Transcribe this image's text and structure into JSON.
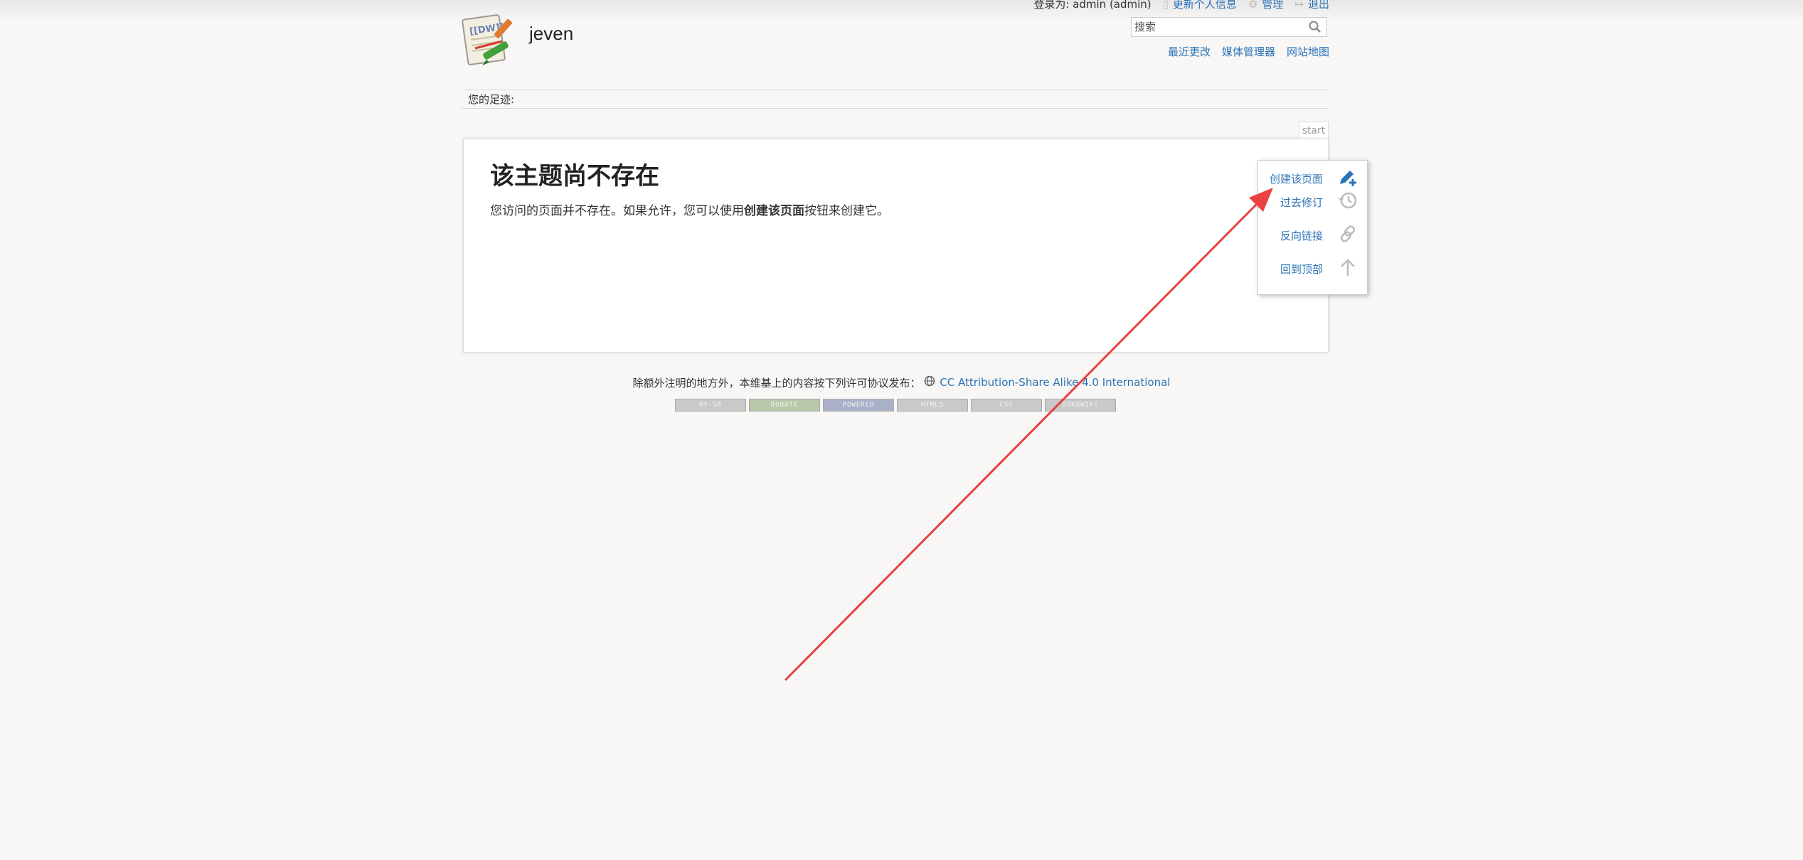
{
  "site": {
    "title": "jeven"
  },
  "user_tools": {
    "logged_in_as": "登录为: admin (admin)",
    "update_profile": "更新个人信息",
    "admin": "管理",
    "logout": "退出"
  },
  "search": {
    "placeholder": "搜索"
  },
  "site_tools": {
    "recent_changes": "最近更改",
    "media_manager": "媒体管理器",
    "sitemap": "网站地图"
  },
  "breadcrumbs": {
    "label": "您的足迹:"
  },
  "page_id": "start",
  "content": {
    "heading": "该主题尚不存在",
    "body_prefix": "您访问的页面并不存在。如果允许，您可以使用",
    "body_bold": "创建该页面",
    "body_suffix": "按钮来创建它。"
  },
  "page_tools": {
    "create": "创建该页面",
    "revisions": "过去修订",
    "backlinks": "反向链接",
    "top": "回到顶部"
  },
  "footer": {
    "license_prefix": "除额外注明的地方外，本维基上的内容按下列许可协议发布：",
    "license_link": "CC Attribution-Share Alike 4.0 International",
    "badges": [
      "BY-SA",
      "DONATE",
      "POWERED",
      "HTML5",
      "CSS",
      "DOKUWIKI"
    ]
  },
  "colors": {
    "link": "#2b73b7",
    "annotation_arrow": "#e8413f",
    "background": "#f8f7f5"
  }
}
